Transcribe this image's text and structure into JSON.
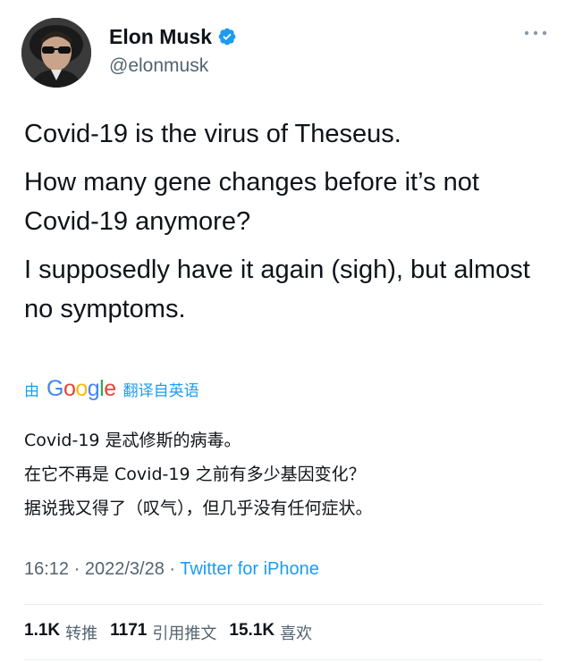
{
  "author": {
    "display_name": "Elon Musk",
    "handle": "@elonmusk",
    "verified": true
  },
  "tweet": {
    "paragraphs": [
      "Covid-19 is the virus of Theseus.",
      "How many gene changes before it’s not Covid-19 anymore?",
      "I supposedly have it again (sigh), but almost no symptoms."
    ]
  },
  "translation": {
    "by_label": "由",
    "provider_letters": [
      "G",
      "o",
      "o",
      "g",
      "l",
      "e"
    ],
    "from_label": "翻译自英语",
    "paragraphs": [
      "Covid-19 是忒修斯的病毒。",
      "在它不再是 Covid-19 之前有多少基因变化？",
      "据说我又得了（叹气），但几乎没有任何症状。"
    ]
  },
  "meta": {
    "time": "16:12",
    "date": "2022/3/28",
    "separator": " · ",
    "source": "Twitter for iPhone"
  },
  "stats": {
    "retweets_count": "1.1K",
    "retweets_label": "转推",
    "quotes_count": "1171",
    "quotes_label": "引用推文",
    "likes_count": "15.1K",
    "likes_label": "喜欢"
  },
  "colors": {
    "accent": "#1d9bf0",
    "text": "#0f1419",
    "secondary": "#536471"
  },
  "icons": [
    "avatar",
    "verified-badge-icon",
    "more-options-icon"
  ]
}
